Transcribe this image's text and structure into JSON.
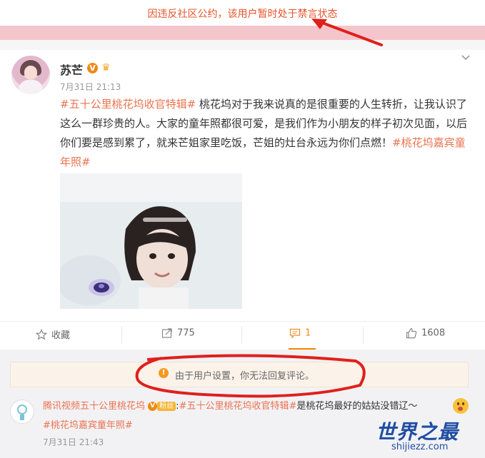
{
  "banner": {
    "text": "因违反社区公约，该用户暂时处于禁言状态"
  },
  "post": {
    "author": {
      "name": "苏芒"
    },
    "time": "7月31日 21:13",
    "text": {
      "tag1": "#五十公里桃花坞收官特辑#",
      "body": " 桃花坞对于我来说真的是很重要的人生转折，让我认识了这么一群珍贵的人。大家的童年照都很可爱，是我们作为小朋友的样子初次见面，以后你们要是感到累了，就来芒姐家里吃饭，芒姐的灶台永远为你们点燃！",
      "tag2": "#桃花坞嘉宾童年照#"
    }
  },
  "actions": {
    "favorite": {
      "label": "收藏",
      "icon": "star-icon"
    },
    "repost": {
      "count": "775",
      "icon": "repost-icon"
    },
    "comment": {
      "count": "1",
      "icon": "comment-icon"
    },
    "like": {
      "count": "1608",
      "icon": "thumbs-up-icon"
    }
  },
  "reply_notice": {
    "text": "由于用户设置，你无法回复评论。",
    "icon": "warning-icon"
  },
  "comment": {
    "author": "腾讯视频五十公里桃花坞",
    "badge": "粉丝",
    "tag1": "#五十公里桃花坞收官特辑#",
    "body": "是桃花坞最好的姑姑没错辽～",
    "tag2": "#桃花坞嘉宾童年照#",
    "time": "7月31日 21:43"
  },
  "watermark": {
    "main": "世界之最",
    "sub": "shijiezz.com"
  },
  "colors": {
    "accent": "#eb7350",
    "ban": "#e8542a",
    "annotation": "#e0201b",
    "watermark": "#1f4ea3"
  }
}
